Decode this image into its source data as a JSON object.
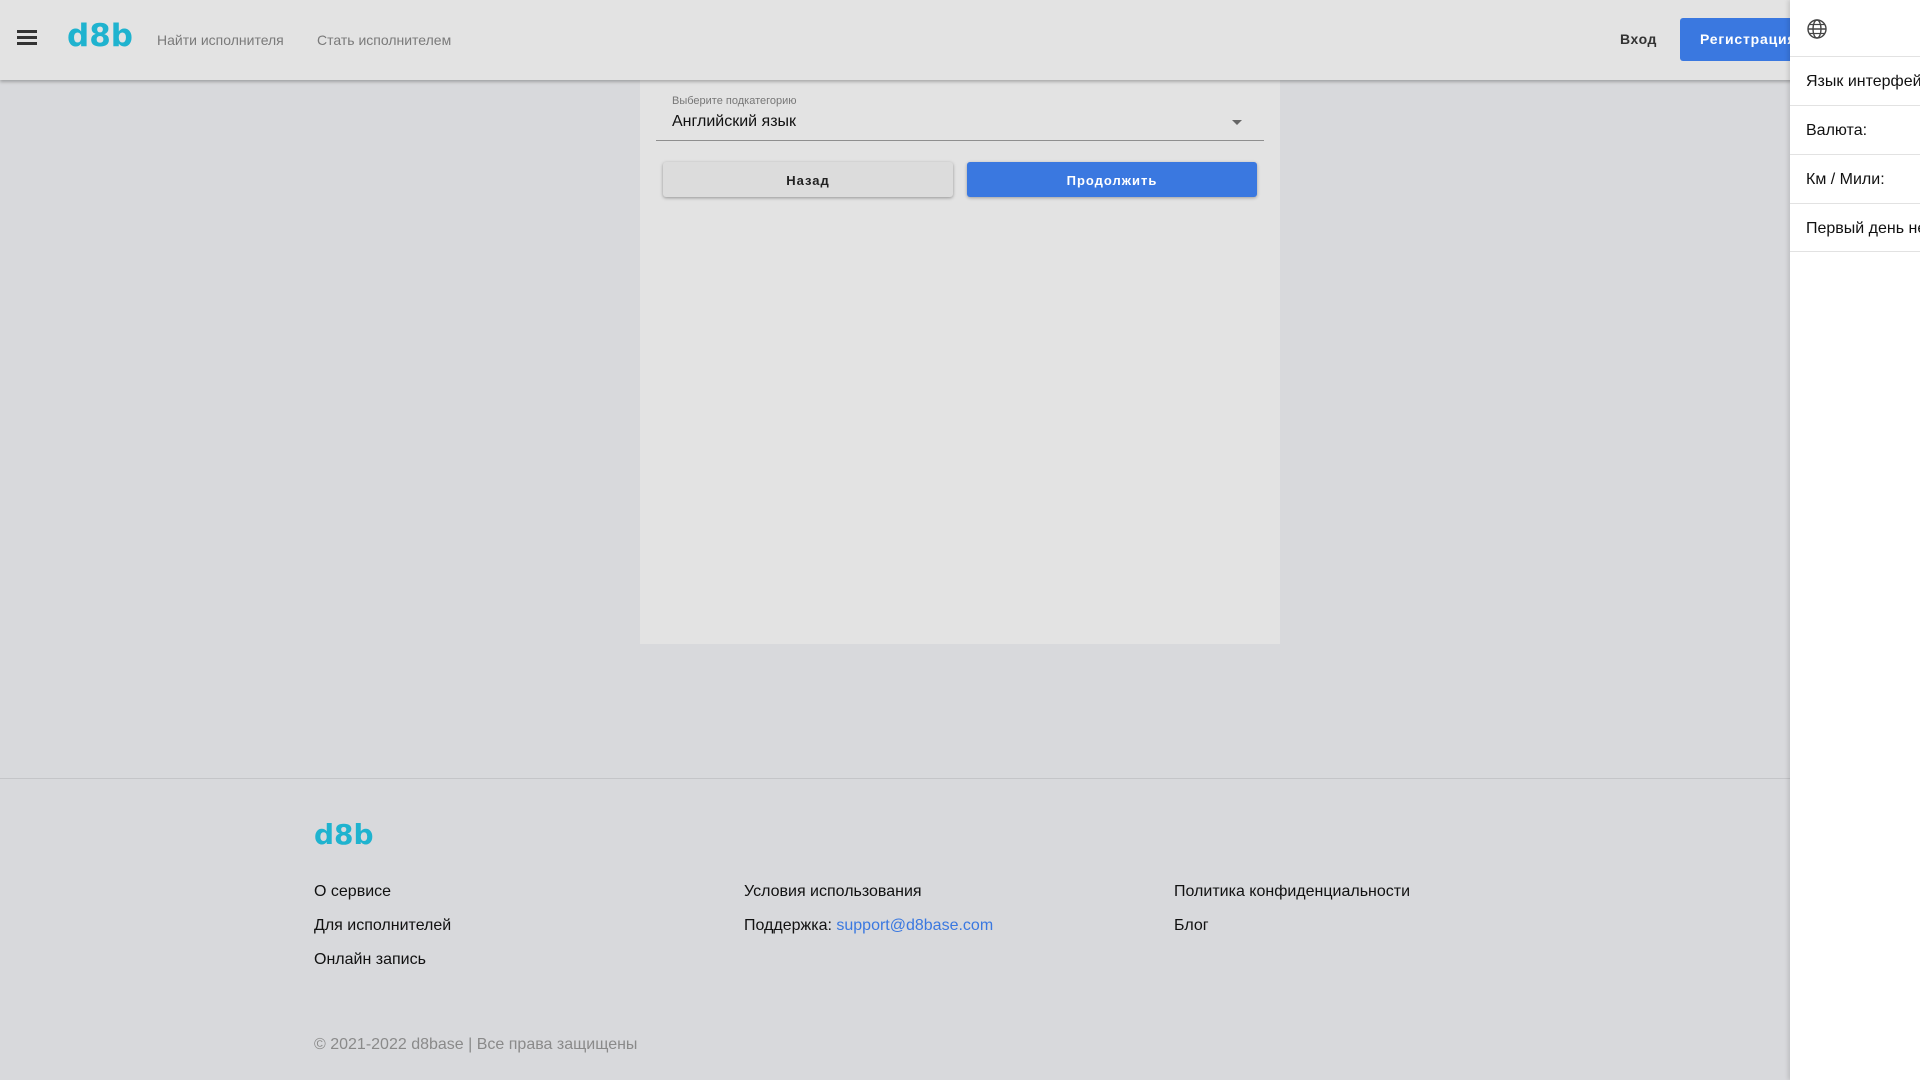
{
  "header": {
    "logo": "d8b",
    "nav": [
      "Найти исполнителя",
      "Стать исполнителем"
    ],
    "login": "Вход",
    "register": "Регистрация"
  },
  "form": {
    "subcategory_label": "Выберите подкатегорию",
    "subcategory_value": "Английский язык",
    "back_button": "Назад",
    "continue_button": "Продолжить"
  },
  "footer": {
    "logo": "d8b",
    "col1": [
      "О сервисе",
      "Для исполнителей",
      "Онлайн запись"
    ],
    "col2_terms": "Условия использования",
    "col2_support_label": "Поддержка:",
    "col2_support_email": "support@d8base.com",
    "col3": [
      "Политика конфиденциальности",
      "Блог"
    ],
    "copyright": "© 2021-2022 d8base | Все права защищены"
  },
  "settings_panel": {
    "rows": [
      "Язык интерфейса",
      "Валюта:",
      "Км / Мили:",
      "Первый день недели"
    ]
  },
  "colors": {
    "brand": "#1fb3cf",
    "primary": "#3a78e0",
    "background": "#d8d9dc"
  }
}
